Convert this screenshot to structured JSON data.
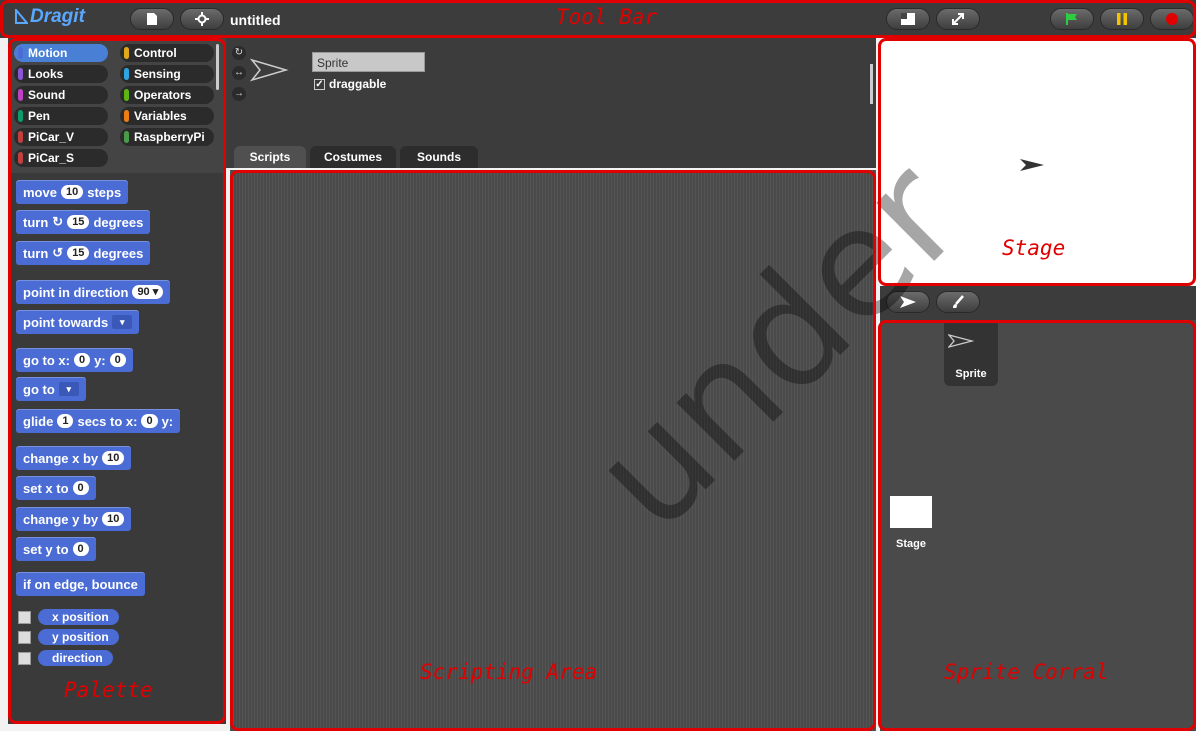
{
  "toolbar": {
    "logo_text": "Dragit",
    "project_title": "untitled"
  },
  "palette": {
    "categories": [
      {
        "label": "Motion",
        "color": "#4a6cd4"
      },
      {
        "label": "Control",
        "color": "#e1a91a"
      },
      {
        "label": "Looks",
        "color": "#8a55d7"
      },
      {
        "label": "Sensing",
        "color": "#2ca5e2"
      },
      {
        "label": "Sound",
        "color": "#bb42c3"
      },
      {
        "label": "Operators",
        "color": "#5cb712"
      },
      {
        "label": "Pen",
        "color": "#0e9a6c"
      },
      {
        "label": "Variables",
        "color": "#ee7d16"
      },
      {
        "label": "PiCar_V",
        "color": "#c04040"
      },
      {
        "label": "RaspberryPi",
        "color": "#4a9a4a"
      },
      {
        "label": "PiCar_S",
        "color": "#c04040"
      }
    ],
    "blocks": {
      "move": {
        "pre": "move",
        "arg": "10",
        "post": "steps"
      },
      "turn_right": {
        "pre": "turn",
        "arg": "15",
        "post": "degrees"
      },
      "turn_left": {
        "pre": "turn",
        "arg": "15",
        "post": "degrees"
      },
      "point_direction": {
        "pre": "point in direction",
        "arg": "90"
      },
      "point_towards": {
        "pre": "point towards"
      },
      "go_to_xy": {
        "pre": "go to x:",
        "x": "0",
        "mid": "y:",
        "y": "0"
      },
      "go_to": {
        "pre": "go to"
      },
      "glide": {
        "pre": "glide",
        "secs": "1",
        "mid": "secs to x:",
        "x": "0",
        "post": "y:"
      },
      "change_x": {
        "pre": "change x by",
        "arg": "10"
      },
      "set_x": {
        "pre": "set x to",
        "arg": "0"
      },
      "change_y": {
        "pre": "change y by",
        "arg": "10"
      },
      "set_y": {
        "pre": "set y to",
        "arg": "0"
      },
      "bounce": {
        "pre": "if on edge, bounce"
      }
    },
    "reporters": [
      "x position",
      "y position",
      "direction"
    ]
  },
  "sprite_bar": {
    "name": "Sprite",
    "draggable_label": "draggable",
    "draggable_checked": true,
    "tabs": [
      "Scripts",
      "Costumes",
      "Sounds"
    ],
    "active_tab": "Scripts"
  },
  "corral": {
    "sprite_label": "Sprite",
    "stage_label": "Stage"
  },
  "annotations": {
    "tool_bar": "Tool Bar",
    "stage": "Stage",
    "palette": "Palette",
    "scripting_area": "Scripting Area",
    "sprite_corral": "Sprite Corral"
  },
  "watermark": "under",
  "colors": {
    "annotation": "#e00000",
    "motion_block": "#4a6cd4",
    "green_flag": "#2ecc40",
    "pause": "#f5c400",
    "stop": "#e00000"
  }
}
